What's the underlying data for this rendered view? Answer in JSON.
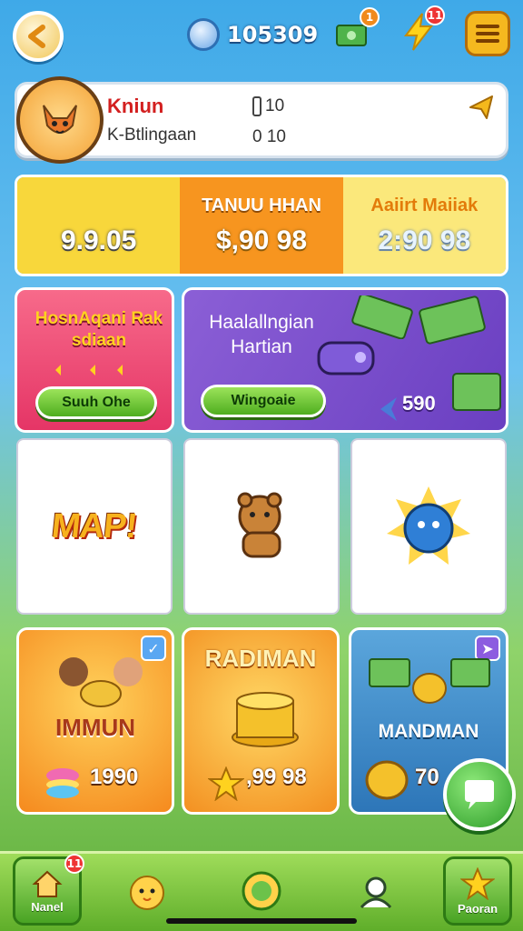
{
  "header": {
    "coin_count": "105309",
    "cash_badge": "1",
    "energy_badge": "11"
  },
  "profile": {
    "name": "Kniun",
    "subtitle": "K-Btlingaan",
    "stat1": "10",
    "stat2": "0 10"
  },
  "rates": [
    {
      "title": "",
      "value": "9.9.05"
    },
    {
      "title": "TANUU HHAN",
      "value": "$,90 98"
    },
    {
      "title": "Aaiirt Maiiak",
      "value": "2:90 98"
    }
  ],
  "promo_left": {
    "title": "HosnAqani Rak sdiaan",
    "button": "Suuh Ohe"
  },
  "promo_right": {
    "title": "Haalallngian Hartian",
    "button": "Wingoaie",
    "price": "590"
  },
  "tiles": [
    {
      "label": "MAP!",
      "icon": "map-logo"
    },
    {
      "label": "",
      "icon": "bear-icon"
    },
    {
      "label": "",
      "icon": "blue-creature-icon"
    }
  ],
  "cards": [
    {
      "title": "IMMUN",
      "price": "1990"
    },
    {
      "title": "RADIMAN",
      "price": ",99 98"
    },
    {
      "title": "MANDMAN",
      "price": "70"
    }
  ],
  "bottom_nav": {
    "home_label": "Nanel",
    "home_badge": "11",
    "ranking_label": "Paoran"
  },
  "colors": {
    "sky": "#3fa9e8",
    "grass": "#5fae3a",
    "accent_orange": "#f7951f",
    "accent_pink": "#e53566",
    "accent_purple": "#7b4fcc"
  }
}
